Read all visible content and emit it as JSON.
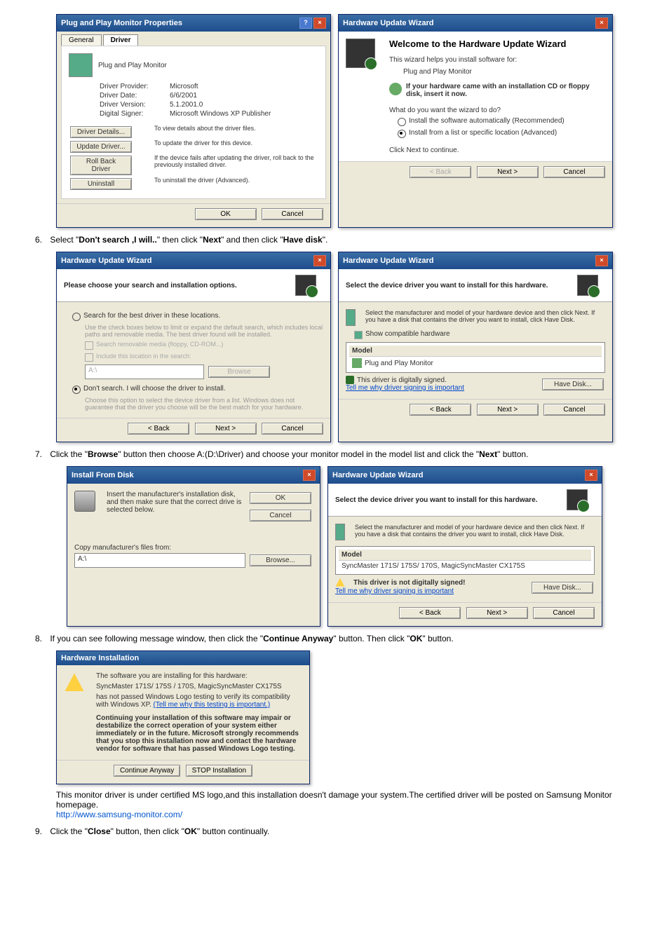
{
  "step6": {
    "number": "6.",
    "text_before": "Select \"",
    "bold1": "Don't search ,I will..",
    "text_mid1": "\" then click \"",
    "bold2": "Next",
    "text_mid2": "\" and then click \"",
    "bold3": "Have disk",
    "text_after": "\"."
  },
  "step7": {
    "number": "7.",
    "text_before": "Click the \"",
    "bold1": "Browse",
    "text_mid1": "\" button then choose A:(D:\\Driver) and choose your monitor model in the model list and click the \"",
    "bold2": "Next",
    "text_after": "\" button."
  },
  "step8": {
    "number": "8.",
    "text_before": "If you can see following message window, then click the \"",
    "bold1": "Continue Anyway",
    "text_mid1": "\" button. Then click \"",
    "bold2": "OK",
    "text_after": "\" button."
  },
  "step9": {
    "number": "9.",
    "text_before": "Click the \"",
    "bold1": "Close",
    "text_mid1": "\" button, then click \"",
    "bold2": "OK",
    "text_after": "\" button continually."
  },
  "note": {
    "line1": "This monitor driver is under certified MS logo,and this installation doesn't damage your system.The certified driver will be posted on Samsung Monitor homepage.",
    "link": "http://www.samsung-monitor.com/"
  },
  "dlg1": {
    "title": "Plug and Play Monitor Properties",
    "tab_general": "General",
    "tab_driver": "Driver",
    "heading": "Plug and Play Monitor",
    "r1k": "Driver Provider:",
    "r1v": "Microsoft",
    "r2k": "Driver Date:",
    "r2v": "6/6/2001",
    "r3k": "Driver Version:",
    "r3v": "5.1.2001.0",
    "r4k": "Digital Signer:",
    "r4v": "Microsoft Windows XP Publisher",
    "b1": "Driver Details...",
    "b1d": "To view details about the driver files.",
    "b2": "Update Driver...",
    "b2d": "To update the driver for this device.",
    "b3": "Roll Back Driver",
    "b3d": "If the device fails after updating the driver, roll back to the previously installed driver.",
    "b4": "Uninstall",
    "b4d": "To uninstall the driver (Advanced).",
    "ok": "OK",
    "cancel": "Cancel"
  },
  "dlg2": {
    "title": "Hardware Update Wizard",
    "welcome": "Welcome to the Hardware Update Wizard",
    "line1": "This wizard helps you install software for:",
    "device": "Plug and Play Monitor",
    "cd": "If your hardware came with an installation CD or floppy disk, insert it now.",
    "q": "What do you want the wizard to do?",
    "opt1": "Install the software automatically (Recommended)",
    "opt2": "Install from a list or specific location (Advanced)",
    "cont": "Click Next to continue.",
    "back": "< Back",
    "next": "Next >",
    "cancel": "Cancel"
  },
  "dlg3": {
    "title": "Hardware Update Wizard",
    "heading": "Please choose your search and installation options.",
    "opt1": "Search for the best driver in these locations.",
    "opt1sub": "Use the check boxes below to limit or expand the default search, which includes local paths and removable media. The best driver found will be installed.",
    "c1": "Search removable media (floppy, CD-ROM...)",
    "c2": "Include this location in the search:",
    "path": "A:\\",
    "browse": "Browse",
    "opt2": "Don't search. I will choose the driver to install.",
    "opt2sub": "Choose this option to select the device driver from a list. Windows does not guarantee that the driver you choose will be the best match for your hardware.",
    "back": "< Back",
    "next": "Next >",
    "cancel": "Cancel"
  },
  "dlg4": {
    "title": "Hardware Update Wizard",
    "heading": "Select the device driver you want to install for this hardware.",
    "sub": "Select the manufacturer and model of your hardware device and then click Next. If you have a disk that contains the driver you want to install, click Have Disk.",
    "showcompat": "Show compatible hardware",
    "model_h": "Model",
    "model_v": "Plug and Play Monitor",
    "signed": "This driver is digitally signed.",
    "tell": "Tell me why driver signing is important",
    "havedisk": "Have Disk...",
    "back": "< Back",
    "next": "Next >",
    "cancel": "Cancel"
  },
  "dlg5": {
    "title": "Install From Disk",
    "text": "Insert the manufacturer's installation disk, and then make sure that the correct drive is selected below.",
    "ok": "OK",
    "cancel": "Cancel",
    "copy": "Copy manufacturer's files from:",
    "path": "A:\\",
    "browse": "Browse..."
  },
  "dlg6": {
    "title": "Hardware Update Wizard",
    "heading": "Select the device driver you want to install for this hardware.",
    "sub": "Select the manufacturer and model of your hardware device and then click Next. If you have a disk that contains the driver you want to install, click Have Disk.",
    "model_h": "Model",
    "model_v": "SyncMaster 171S/ 175S/ 170S, MagicSyncMaster CX175S",
    "signed": "This driver is not digitally signed!",
    "tell": "Tell me why driver signing is important",
    "havedisk": "Have Disk...",
    "back": "< Back",
    "next": "Next >",
    "cancel": "Cancel"
  },
  "dlg7": {
    "title": "Hardware Installation",
    "line1": "The software you are installing for this hardware:",
    "device": "SyncMaster 171S/ 175S / 170S, MagicSyncMaster CX175S",
    "line2a": "has not passed Windows Logo testing to verify its compatibility with Windows XP. ",
    "line2link": "(Tell me why this testing is important.)",
    "line3": "Continuing your installation of this software may impair or destabilize the correct operation of your system either immediately or in the future. Microsoft strongly recommends that you stop this installation now and contact the hardware vendor for software that has passed Windows Logo testing.",
    "cont": "Continue Anyway",
    "stop": "STOP Installation"
  }
}
